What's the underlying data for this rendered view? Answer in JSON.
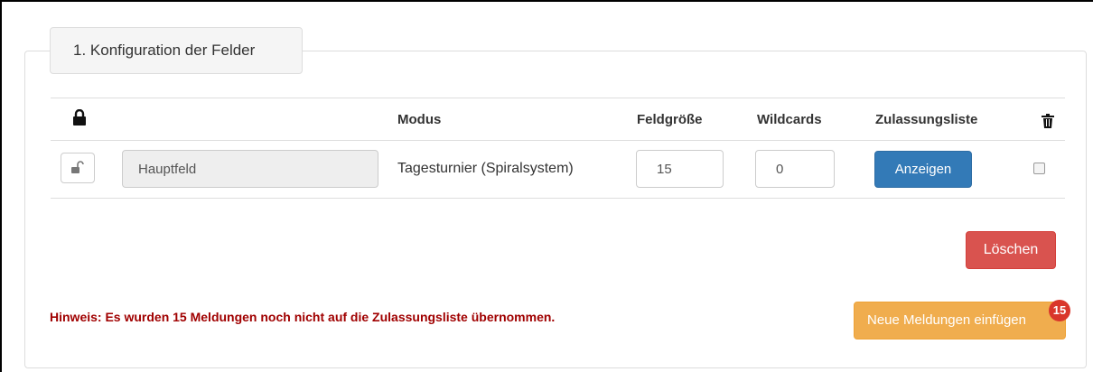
{
  "section": {
    "legend": "1. Konfiguration der Felder"
  },
  "table": {
    "headers": {
      "modus": "Modus",
      "feldgroesse": "Feldgröße",
      "wildcards": "Wildcards",
      "zulassungsliste": "Zulassungsliste"
    },
    "row": {
      "name": "Hauptfeld",
      "modus": "Tagesturnier (Spiralsystem)",
      "feldgroesse": "15",
      "wildcards": "0",
      "show_button": "Anzeigen",
      "checked": false
    }
  },
  "delete_button": "Löschen",
  "hint": "Hinweis: Es wurden 15 Meldungen noch nicht auf die Zulassungsliste übernommen.",
  "new_entries_button": "Neue Meldungen einfügen",
  "badge_count": "15",
  "colors": {
    "primary": "#337ab7",
    "danger": "#d9534f",
    "warning": "#f0ad4e",
    "hint": "#a00000",
    "badge": "#d9362b"
  },
  "icons": {
    "header_lock": "lock-icon",
    "row_lock": "unlock-icon",
    "delete_column": "trash-icon"
  }
}
